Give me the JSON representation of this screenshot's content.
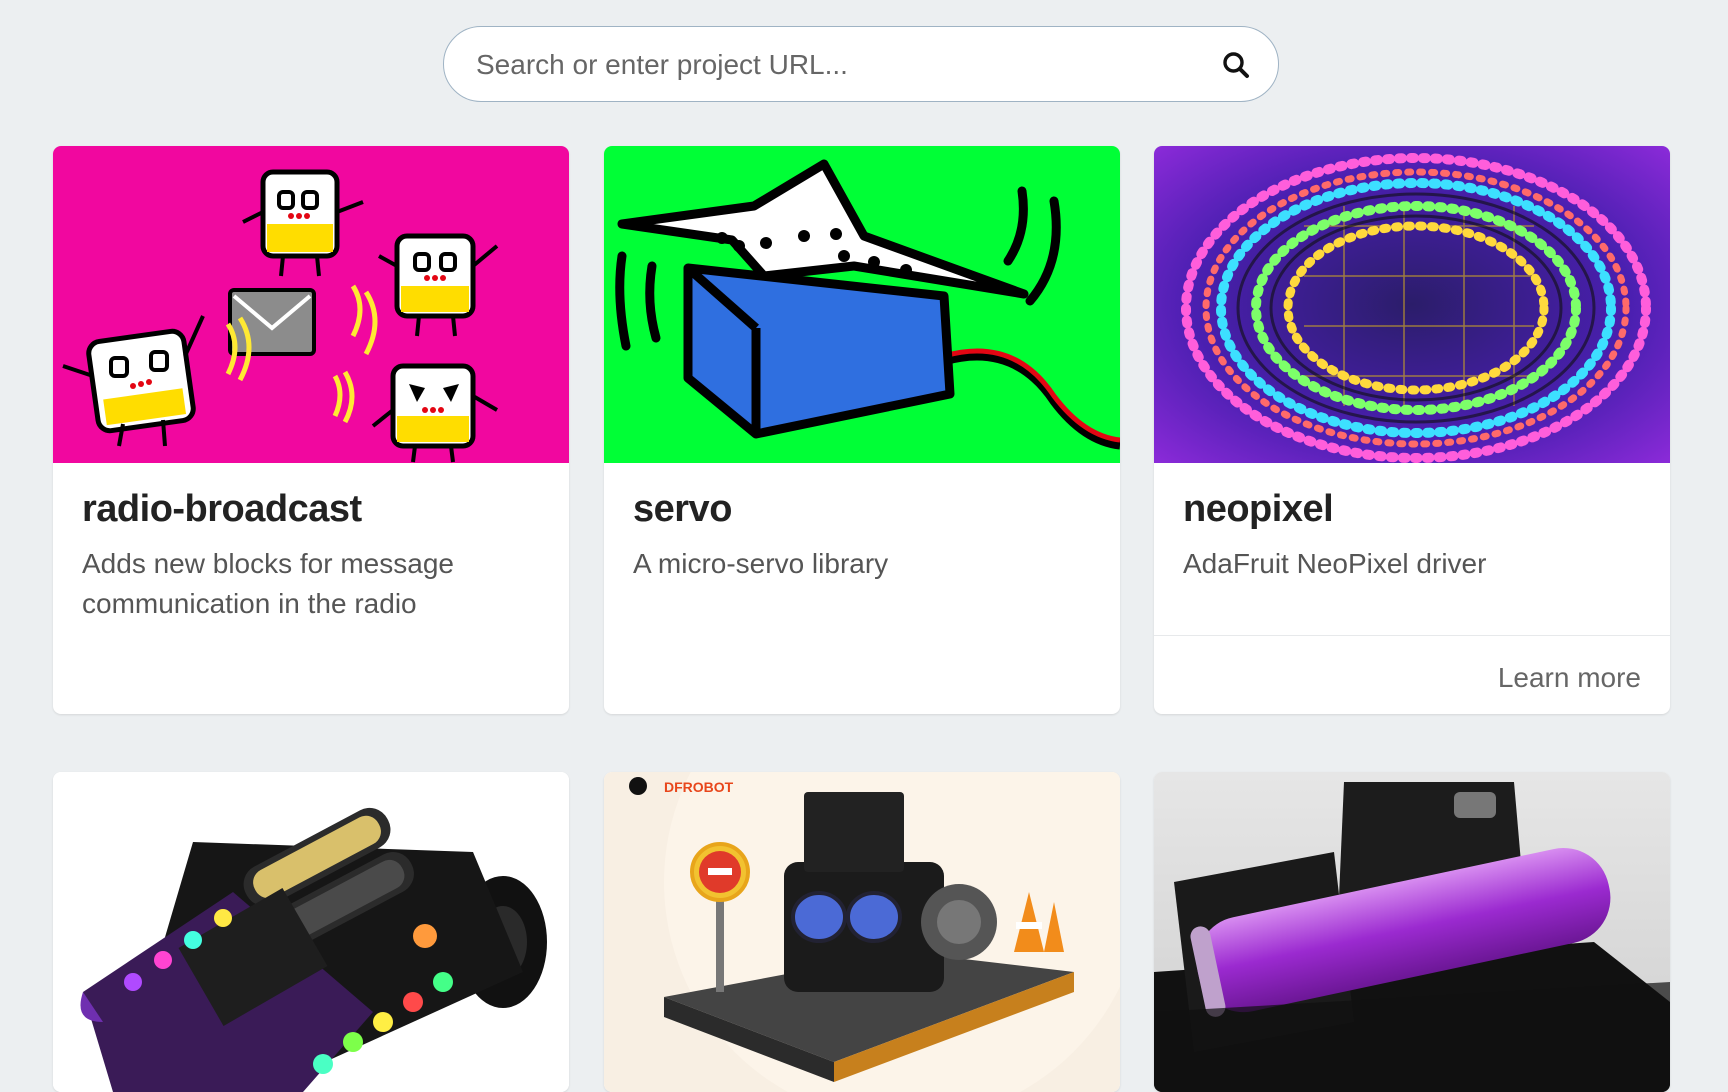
{
  "search": {
    "placeholder": "Search or enter project URL...",
    "icon": "search-icon"
  },
  "cards": [
    {
      "name": "radio-broadcast",
      "description": "Adds new blocks for message communication in the radio",
      "image": "radio-broadcast-illustration",
      "image_bg": "#f1079f"
    },
    {
      "name": "servo",
      "description": "A micro-servo library",
      "image": "servo-illustration",
      "image_bg": "#00ff36"
    },
    {
      "name": "neopixel",
      "description": "AdaFruit NeoPixel driver",
      "image": "neopixel-led-strip-photo",
      "learn_more": "Learn more"
    },
    {
      "image": "bitbot-robot-photo"
    },
    {
      "image": "dfrobot-maqueen-robot-photo",
      "logo_text": "DFROBOT"
    },
    {
      "image": "microbit-battery-holder-photo"
    }
  ]
}
